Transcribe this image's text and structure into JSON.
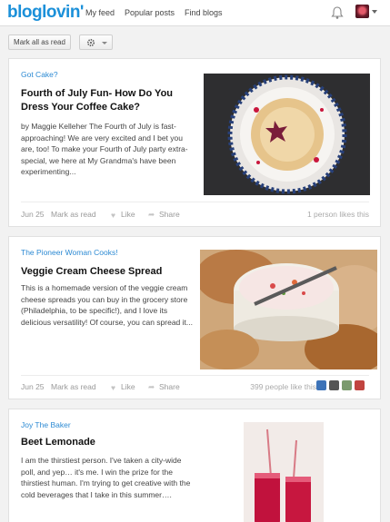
{
  "brand": {
    "logo": "bloglovin'",
    "accent": "#1b90d9"
  },
  "nav": {
    "my_feed": "My feed",
    "popular_posts": "Popular posts",
    "find_blogs": "Find blogs"
  },
  "header": {
    "bell_icon": "bell-icon",
    "avatar": "user-avatar"
  },
  "toolbar": {
    "mark_all_read": "Mark all as read",
    "settings_icon": "gear-icon"
  },
  "posts": [
    {
      "source": "Got Cake?",
      "title": "Fourth of July Fun- How Do You Dress Your Coffee Cake?",
      "excerpt": "by Maggie Kelleher The Fourth of July is fast-approaching! We are very excited and I bet you are, too! To make your Fourth of July party extra-special, we here at My Grandma's have been experimenting...",
      "date": "Jun 25",
      "mark_read": "Mark as read",
      "like": "Like",
      "share": "Share",
      "likes_text": "1 person likes this"
    },
    {
      "source": "The Pioneer Woman Cooks!",
      "title": "Veggie Cream Cheese Spread",
      "excerpt": "This is a homemade version of the veggie cream cheese spreads you can buy in the grocery store (Philadelphia, to be specific!), and I love its delicious versatility! Of course, you can spread it...",
      "date": "Jun 25",
      "mark_read": "Mark as read",
      "like": "Like",
      "share": "Share",
      "likes_text": "399 people like this"
    },
    {
      "source": "Joy The Baker",
      "title": "Beet Lemonade",
      "excerpt": "I am the thirstiest person. I've taken a city-wide poll, and yep… it's me. I win the prize for the thirstiest human. I'm trying to get creative with the cold beverages that I take in this summer…."
    }
  ]
}
